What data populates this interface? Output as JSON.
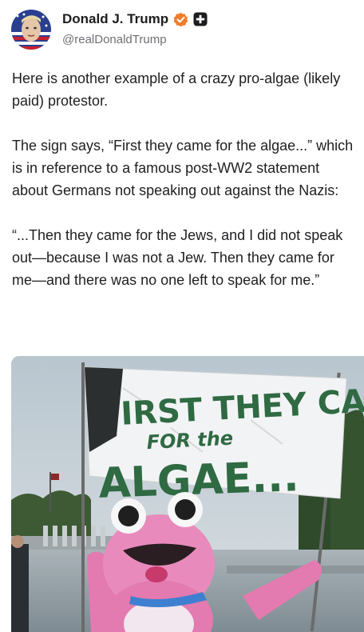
{
  "post": {
    "display_name": "Donald J. Trump",
    "handle": "@realDonaldTrump",
    "paragraphs": [
      "Here is another example of a crazy pro-algae (likely paid) protestor.",
      "The sign says, “First they came for the algae...” which is in reference to a famous post-WW2 statement about Germans not speaking out against the Nazis:",
      "“...Then they came for the Jews, and I did not speak out—because I was not a Jew. Then they came for me—and there was no one left to speak for me.”"
    ]
  },
  "icons": {
    "verified": "verified-badge-icon",
    "badge": "plus-badge-icon"
  },
  "media": {
    "sign_lines": [
      "IRST THEY CAME",
      "FOR the",
      "ALGAE..."
    ]
  },
  "colors": {
    "verified": "#f07c2a",
    "text": "#1f1f22",
    "handle": "#6f6f76",
    "sign_paint": "#2f6a43",
    "costume_pink": "#e37ab0"
  }
}
